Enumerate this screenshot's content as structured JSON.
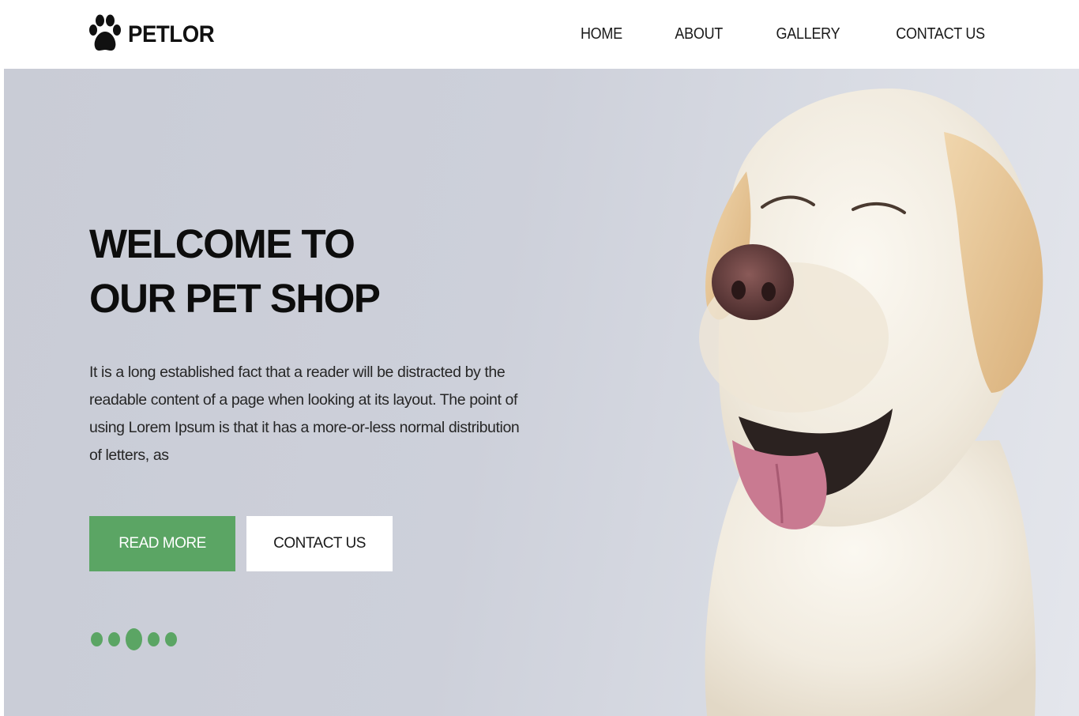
{
  "brand": {
    "name": "PETLOR",
    "logo_icon": "paw-icon"
  },
  "nav": {
    "items": [
      {
        "label": "HOME"
      },
      {
        "label": "ABOUT"
      },
      {
        "label": "GALLERY"
      },
      {
        "label": "CONTACT US"
      }
    ]
  },
  "hero": {
    "title_line1": "WELCOME TO",
    "title_line2": "OUR PET SHOP",
    "description": "It is a long established fact that a reader will be distracted by the readable content of a page when looking at its layout. The point of using Lorem Ipsum is that it has a more-or-less normal distribution of letters, as",
    "primary_button": "READ MORE",
    "secondary_button": "CONTACT US",
    "carousel": {
      "slide_count": 5,
      "active_slide": 3
    }
  },
  "colors": {
    "accent": "#5ba564",
    "hero_background": "#cdd0da",
    "text_dark": "#0d0d0d"
  }
}
